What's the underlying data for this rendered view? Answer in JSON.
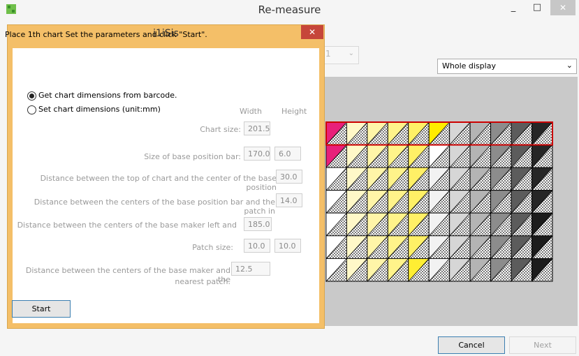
{
  "main_window": {
    "title": "Re-measure",
    "minimize_glyph": "_",
    "maximize_glyph": "□",
    "close_glyph": "✕",
    "dimension_select_value": "1",
    "display_select_value": "Whole display",
    "cancel_label": "Cancel",
    "next_label": "Next"
  },
  "dialog": {
    "title": "i1iSis",
    "close_glyph": "✕",
    "instruction": "Place 1th chart Set the parameters and click \"Start\".",
    "radio_barcode": "Get chart dimensions from barcode.",
    "radio_manual": "Set chart dimensions (unit:mm)",
    "col_width": "Width",
    "col_height": "Height",
    "fields": {
      "chart_size": {
        "label": "Chart size:",
        "width": "201.5"
      },
      "base_bar_size": {
        "label": "Size of base position bar:",
        "width": "170.0",
        "height": "6.0"
      },
      "top_to_base_center": {
        "label": "Distance between the top of chart and the center of the base position",
        "width": "30.0"
      },
      "base_bar_to_patch": {
        "label": "Distance between the centers of the base position bar and the patch in",
        "width": "14.0"
      },
      "base_maker_left": {
        "label": "Distance between the centers of the base maker left and",
        "width": "185.0"
      },
      "patch_size": {
        "label": "Patch size:",
        "width": "10.0",
        "height": "10.0"
      },
      "maker_to_patch_line1": "Distance between the centers of the base maker and the",
      "maker_to_patch_line2": "nearest patch.",
      "maker_to_patch_value": "12.5"
    },
    "start_label": "Start"
  },
  "colors": {
    "dialog_frame": "#f4bf68",
    "dialog_close": "#c6463a",
    "preview_bg": "#c9c9c9",
    "highlight_row": "#cc0000"
  },
  "chart_preview": {
    "rows": 7,
    "cols": 11,
    "highlighted_row": 1,
    "patch_colors": [
      [
        "#e8207a",
        "#fff8c8",
        "#fff5a8",
        "#fff38a",
        "#fff066",
        "#ffec00",
        "#d6d6d6",
        "#b4b4b4",
        "#8c8c8c",
        "#5c5c5c",
        "#262626"
      ],
      [
        "#e8207a",
        "#fff8c8",
        "#fff5a8",
        "#fff38a",
        "#fff066",
        "#ffffff",
        "#d6d6d6",
        "#b4b4b4",
        "#8c8c8c",
        "#5c5c5c",
        "#262626"
      ],
      [
        "#ffffff",
        "#fff8c8",
        "#fff5a8",
        "#fff38a",
        "#fff066",
        "#f2f2f2",
        "#d6d6d6",
        "#b4b4b4",
        "#8c8c8c",
        "#5c5c5c",
        "#262626"
      ],
      [
        "#ffffff",
        "#fff8c8",
        "#fff5a8",
        "#fff38a",
        "#fff066",
        "#f2f2f2",
        "#d6d6d6",
        "#b4b4b4",
        "#8c8c8c",
        "#5c5c5c",
        "#262626"
      ],
      [
        "#ffffff",
        "#fff8c8",
        "#fff5a8",
        "#fff38a",
        "#fff066",
        "#f2f2f2",
        "#d6d6d6",
        "#b4b4b4",
        "#8c8c8c",
        "#5c5c5c",
        "#1c1c1c"
      ],
      [
        "#ffffff",
        "#fff8c8",
        "#fff5a8",
        "#fff38a",
        "#fff066",
        "#f2f2f2",
        "#d6d6d6",
        "#b4b4b4",
        "#8c8c8c",
        "#5c5c5c",
        "#1c1c1c"
      ],
      [
        "#ffffff",
        "#fff8c8",
        "#fff5a8",
        "#fff38a",
        "#ffee33",
        "#f2f2f2",
        "#d6d6d6",
        "#b4b4b4",
        "#8c8c8c",
        "#5c5c5c",
        "#1c1c1c"
      ]
    ]
  }
}
